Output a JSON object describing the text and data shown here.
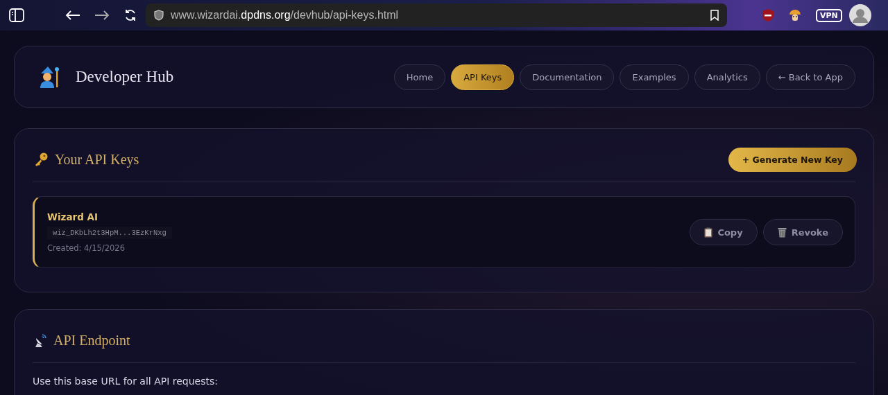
{
  "browser": {
    "url_prefix": "www.wizardai.",
    "url_domain": "dpdns.org",
    "url_path": "/devhub/api-keys.html",
    "vpn_label": "VPN"
  },
  "header": {
    "title": "Developer Hub",
    "nav": [
      {
        "label": "Home",
        "selected": false
      },
      {
        "label": "API Keys",
        "selected": true
      },
      {
        "label": "Documentation",
        "selected": false
      },
      {
        "label": "Examples",
        "selected": false
      },
      {
        "label": "Analytics",
        "selected": false
      },
      {
        "label": "← Back to App",
        "selected": false
      }
    ]
  },
  "keys_section": {
    "title": "Your API Keys",
    "generate_button": "+ Generate New Key",
    "keys": [
      {
        "name": "Wizard AI",
        "key": "wiz_DKbLh2t3HpM...3EzKrNxg",
        "created": "Created: 4/15/2026",
        "copy_button": "Copy",
        "revoke_button": "Revoke"
      }
    ]
  },
  "endpoint_section": {
    "title": "API Endpoint",
    "description": "Use this base URL for all API requests:"
  }
}
